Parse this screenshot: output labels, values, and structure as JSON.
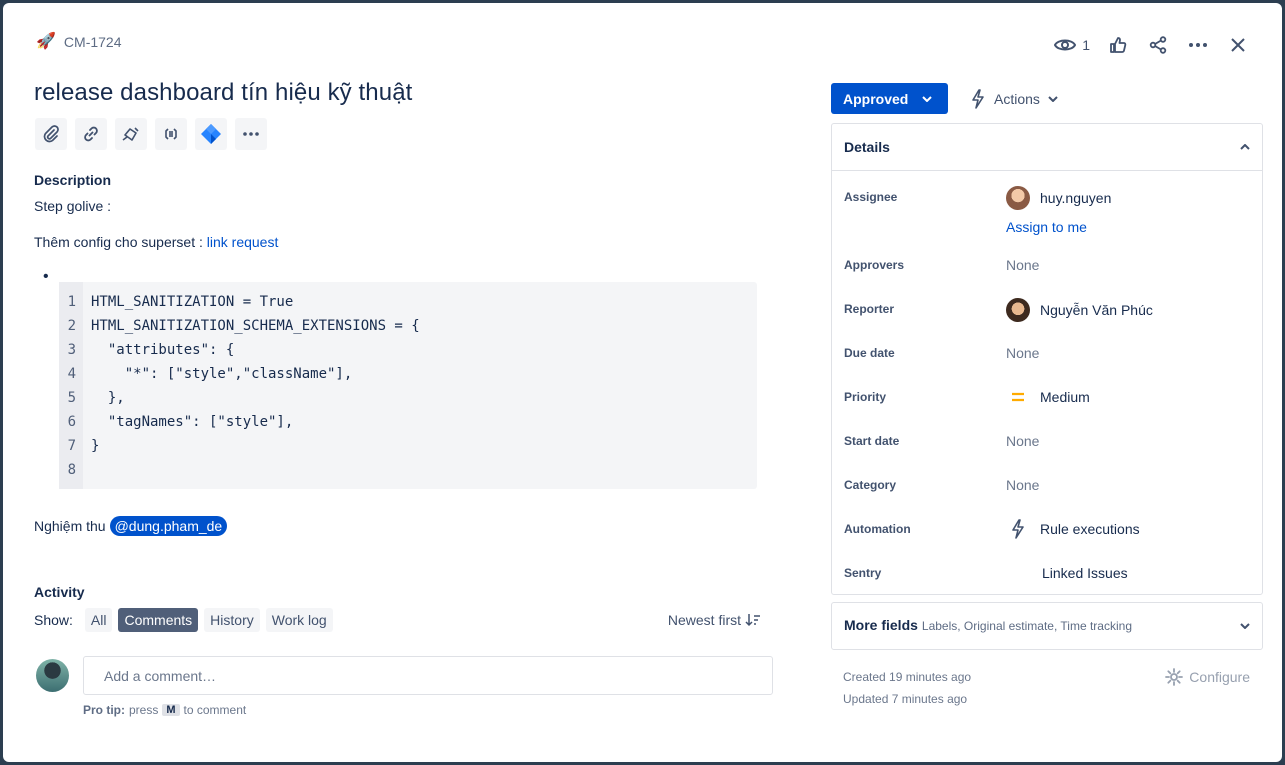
{
  "header": {
    "issue_key": "CM-1724",
    "watch_count": "1"
  },
  "issue": {
    "title": "release dashboard tín hiệu kỹ thuật"
  },
  "description": {
    "label": "Description",
    "line1": "Step golive :",
    "line2_prefix": "Thêm config cho superset : ",
    "line2_link": "link request",
    "bullet": "•",
    "code_line_numbers": [
      "1",
      "2",
      "3",
      "4",
      "5",
      "6",
      "7",
      "8"
    ],
    "code_lines": [
      "HTML_SANITIZATION = True",
      "HTML_SANITIZATION_SCHEMA_EXTENSIONS = {",
      "  \"attributes\": {",
      "    \"*\": [\"style\",\"className\"],",
      "  },",
      "  \"tagNames\": [\"style\"],",
      "}",
      ""
    ],
    "mention_prefix": "Nghiệm thu",
    "mention": "@dung.pham_de"
  },
  "activity": {
    "label": "Activity",
    "show_label": "Show:",
    "filters": [
      "All",
      "Comments",
      "History",
      "Work log"
    ],
    "active_filter": "Comments",
    "sort_label": "Newest first",
    "comment_placeholder": "Add a comment…",
    "protip_label": "Pro tip:",
    "protip_press": "press",
    "protip_key": "M",
    "protip_suffix": "to comment"
  },
  "sidebar": {
    "status": "Approved",
    "actions": "Actions",
    "details_title": "Details",
    "fields": {
      "assignee_label": "Assignee",
      "assignee_value": "huy.nguyen",
      "assign_to_me": "Assign to me",
      "approvers_label": "Approvers",
      "approvers_value": "None",
      "reporter_label": "Reporter",
      "reporter_value": "Nguyễn Văn Phúc",
      "due_label": "Due date",
      "due_value": "None",
      "priority_label": "Priority",
      "priority_value": "Medium",
      "start_label": "Start date",
      "start_value": "None",
      "category_label": "Category",
      "category_value": "None",
      "automation_label": "Automation",
      "automation_value": "Rule executions",
      "sentry_label": "Sentry",
      "sentry_value": "Linked Issues"
    },
    "more_fields_title": "More fields",
    "more_fields_sub": "Labels, Original estimate, Time tracking",
    "created": "Created 19 minutes ago",
    "updated": "Updated 7 minutes ago",
    "configure": "Configure"
  },
  "colors": {
    "primary": "#0052cc",
    "priority_medium": "#ffab00"
  }
}
